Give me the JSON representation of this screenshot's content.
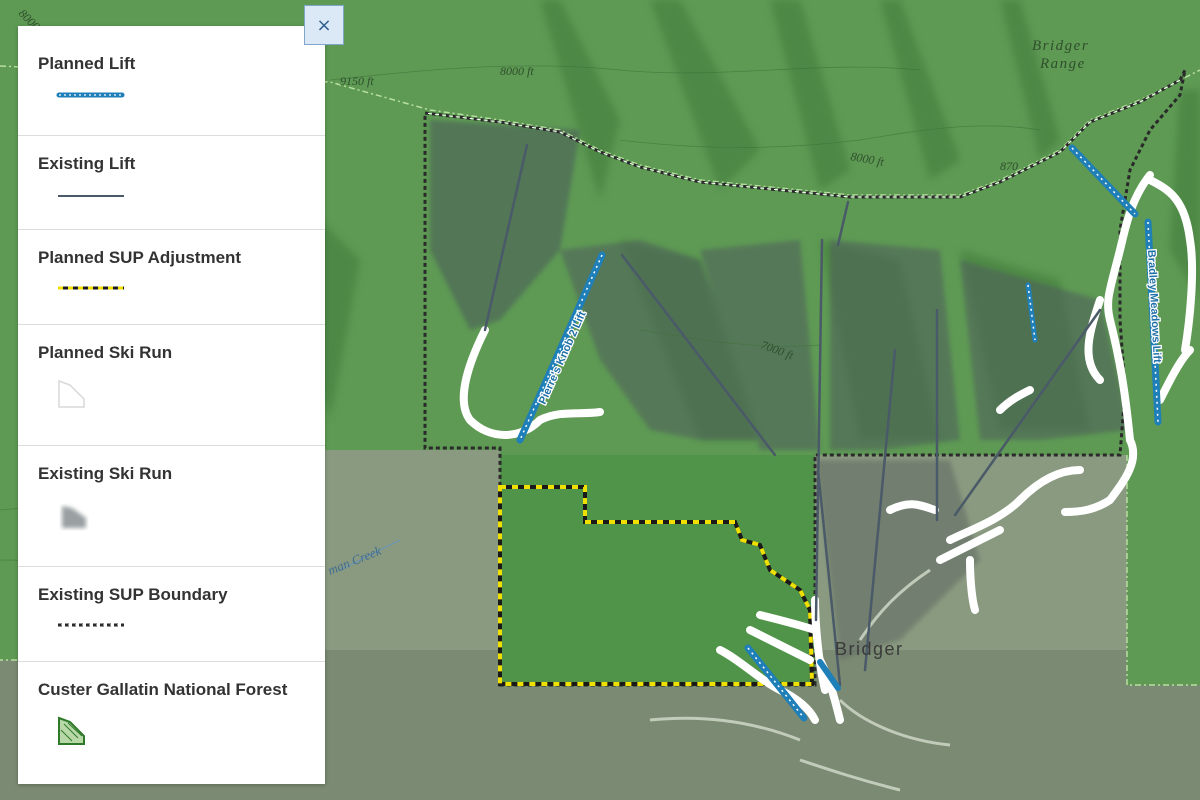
{
  "map": {
    "contour_labels": [
      "8000 ft",
      "9150 ft",
      "8000 ft",
      "870",
      "8000 ft",
      "7000 ft"
    ],
    "range_label_line1": "Bridger",
    "range_label_line2": "Range",
    "creek_label": "man Creek",
    "place_label": "Bridger",
    "lift_labels": {
      "pierres": "Pierre's Knob 2 Lift",
      "bradley": "Bradley Meadows Lift"
    },
    "colors": {
      "forest": "#5e9a54",
      "private_land": "#8a9a80",
      "planned_lift": "#1f7fb8",
      "existing_lift": "#4a5a68",
      "sup_adjustment": "#f0e000",
      "ski_run": "#ffffff",
      "forest_boundary": "#b8e0a0"
    }
  },
  "legend": {
    "close_icon": "×",
    "items": [
      {
        "label": "Planned Lift",
        "icon": "planned-lift-symbol"
      },
      {
        "label": "Existing Lift",
        "icon": "existing-lift-symbol"
      },
      {
        "label": "Planned SUP Adjustment",
        "icon": "planned-sup-adjustment-symbol"
      },
      {
        "label": "Planned Ski Run",
        "icon": "planned-ski-run-symbol"
      },
      {
        "label": "Existing Ski Run",
        "icon": "existing-ski-run-symbol"
      },
      {
        "label": "Existing SUP Boundary",
        "icon": "existing-sup-boundary-symbol"
      },
      {
        "label": "Custer Gallatin National Forest",
        "icon": "national-forest-symbol"
      }
    ]
  }
}
